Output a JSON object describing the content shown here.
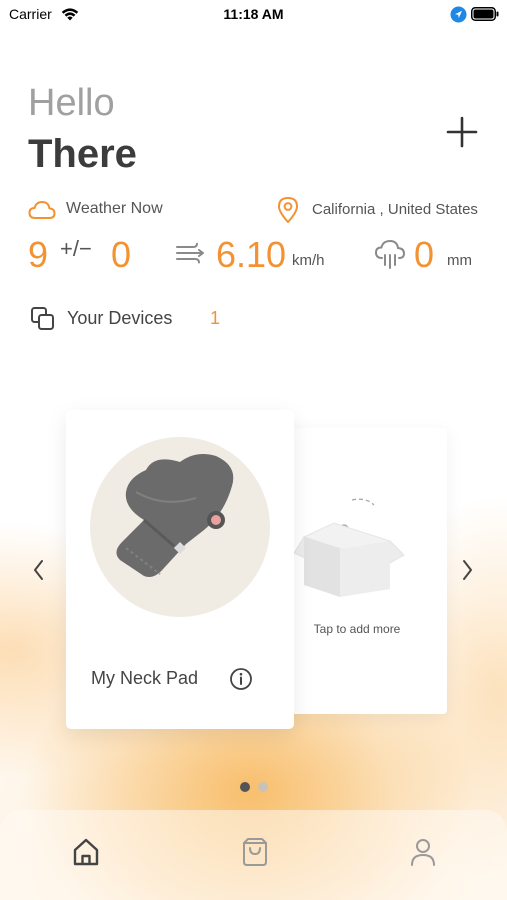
{
  "status_bar": {
    "carrier": "Carrier",
    "time": "11:18 AM"
  },
  "greeting": {
    "line1": "Hello",
    "line2": "There"
  },
  "weather": {
    "label": "Weather Now",
    "location": "California , United States",
    "temperature": "9",
    "plus_minus": "+/−",
    "deviation": "0",
    "wind_speed": "6.10",
    "wind_unit": "km/h",
    "rainfall": "0",
    "rain_unit": "mm"
  },
  "devices": {
    "label": "Your Devices",
    "count": "1"
  },
  "cards": {
    "device_name": "My Neck Pad",
    "add_more": "Tap to add more"
  },
  "pagination": {
    "current": 1,
    "total": 2
  },
  "colors": {
    "accent": "#f39233",
    "text_dark": "#3c3c3c",
    "text_muted": "#a0a0a0"
  },
  "icons": {
    "header": "plus-icon",
    "weather": "cloud-icon",
    "location": "map-pin-icon",
    "wind": "wind-icon",
    "rain": "rain-cloud-icon",
    "devices": "copy-icon",
    "info": "info-icon",
    "tabs": [
      "home-icon",
      "shopping-bag-icon",
      "user-icon"
    ]
  }
}
